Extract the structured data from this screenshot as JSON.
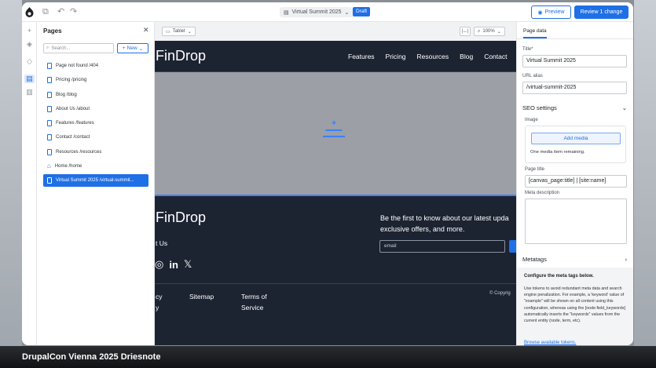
{
  "caption": "DrupalCon Vienna 2025 Driesnote",
  "topbar": {
    "doc_title": "Virtual Summit 2025",
    "status_badge": "Draft",
    "preview_label": "Preview",
    "review_label": "Review 1 change"
  },
  "pages_panel": {
    "title": "Pages",
    "search_placeholder": "Search...",
    "new_label": "New",
    "items": [
      {
        "label": "Page not found /404"
      },
      {
        "label": "Pricing /pricing"
      },
      {
        "label": "Blog /blog"
      },
      {
        "label": "About Us /about"
      },
      {
        "label": "Features /features"
      },
      {
        "label": "Contact /contact"
      },
      {
        "label": "Resources /resources"
      },
      {
        "label": "Home /home",
        "icon": "home-icon"
      },
      {
        "label": "Virtual Summit 2025 /virtual-summit...",
        "active": true
      }
    ]
  },
  "canvas": {
    "device": "Tablet",
    "zoom": "100%",
    "site": {
      "logo": "FinDrop",
      "nav": [
        "Features",
        "Pricing",
        "Resources",
        "Blog",
        "Contact"
      ],
      "footer_logo": "FinDrop",
      "about_text": "t Us",
      "newsletter_line1": "Be the first to know about our latest upda",
      "newsletter_line2": "exclusive offers, and more.",
      "email_placeholder": "email",
      "footer_link_1": "cy",
      "footer_link_1b": "y",
      "footer_link_2": "Sitemap",
      "footer_link_3a": "Terms of",
      "footer_link_3b": "Service",
      "copyright": "© Copyrig"
    }
  },
  "right_panel": {
    "tab": "Page data",
    "title_label": "Title*",
    "title_value": "Virtual Summit 2025",
    "alias_label": "URL alias",
    "alias_value": "/virtual-summit-2025",
    "seo_label": "SEO settings",
    "image_label": "Image",
    "add_media_label": "Add media",
    "media_note": "One media item remaining.",
    "page_title_label": "Page title",
    "page_title_value": "[canvas_page:title] | [site:name]",
    "meta_desc_label": "Meta description",
    "metatags_label": "Metatags",
    "meta_box_title": "Configure the meta tags below.",
    "meta_box_body": "Use tokens to avoid redundant meta data and search engine penalization. For example, a 'keyword' value of \"example\" will be shown on all content using this configuration, whereas using the [node:field_keywords] automatically inserts the \"keywords\" values from the current entity (node, term, etc).",
    "meta_box_link": "Browse available tokens."
  },
  "colors": {
    "accent": "#1f6fe6",
    "site_dark": "#1c2331",
    "hero_gray": "#9c9fa6"
  }
}
